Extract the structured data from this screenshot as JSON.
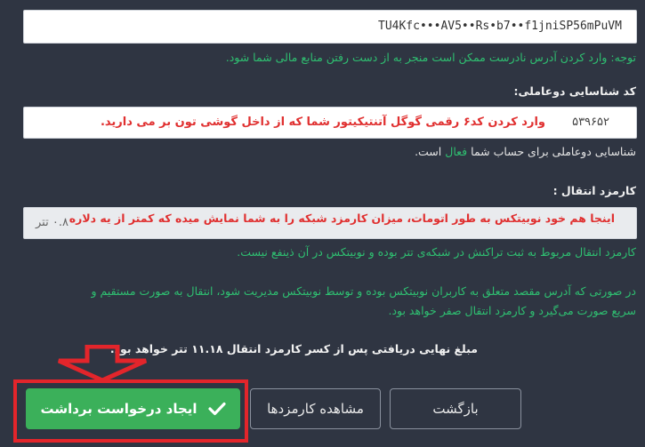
{
  "wallet_address": {
    "value": "TU4Kfc•••AV5••Rs•b7••f1jniSP56mPuVM",
    "note": "توجه: وارد کردن آدرس نادرست ممکن است منجر به از دست رفتن منابع مالی شما شود."
  },
  "two_factor": {
    "label": "کد شناسایی دوعاملی:",
    "value": "۵۳۹۶۵۲",
    "annotation": "وارد کردن کد۶ رقمی گوگل آتنتیکیتور شما که از داخل گوشی تون بر می دارید.",
    "help_prefix": "شناسایی دوعاملی برای حساب شما",
    "help_status": "فعال",
    "help_suffix": "است."
  },
  "fee": {
    "label": "کارمزد انتقال :",
    "value": "۰.۸ تتر",
    "annotation": "اینجا هم خود نوبیتکس به طور اتومات، میزان کارمزد شبکه را به شما نمایش میده که کمتر از یه دلاره",
    "help": "کارمزد انتقال مربوط به ثبت تراکنش در شبکه‌ی تتر بوده و نوبیتکس در آن ذینفع نیست."
  },
  "internal_note": {
    "line1": "در صورتی که آدرس مقصد متعلق به کاربران نوبیتکس بوده و توسط نوبیتکس مدیریت شود، انتقال به صورت مستقیم و",
    "line2": "سریع صورت می‌گیرد و کارمزد انتقال صفر خواهد بود."
  },
  "final_amount": "مبلغ نهایی دریافتی پس از کسر کارمزد انتقال ۱۱.۱۸ تتر خواهد بود.",
  "buttons": {
    "back": "بازگشت",
    "fees": "مشاهده کارمزدها",
    "create": "ایجاد درخواست برداشت"
  },
  "colors": {
    "background": "#2f3542",
    "accent_green": "#2fbf71",
    "primary_button": "#3bb05a",
    "annotation_red": "#e03030",
    "highlight_box": "#e3252b"
  },
  "icons": {
    "check": "check-icon",
    "pointer": "down-arrow-icon"
  }
}
